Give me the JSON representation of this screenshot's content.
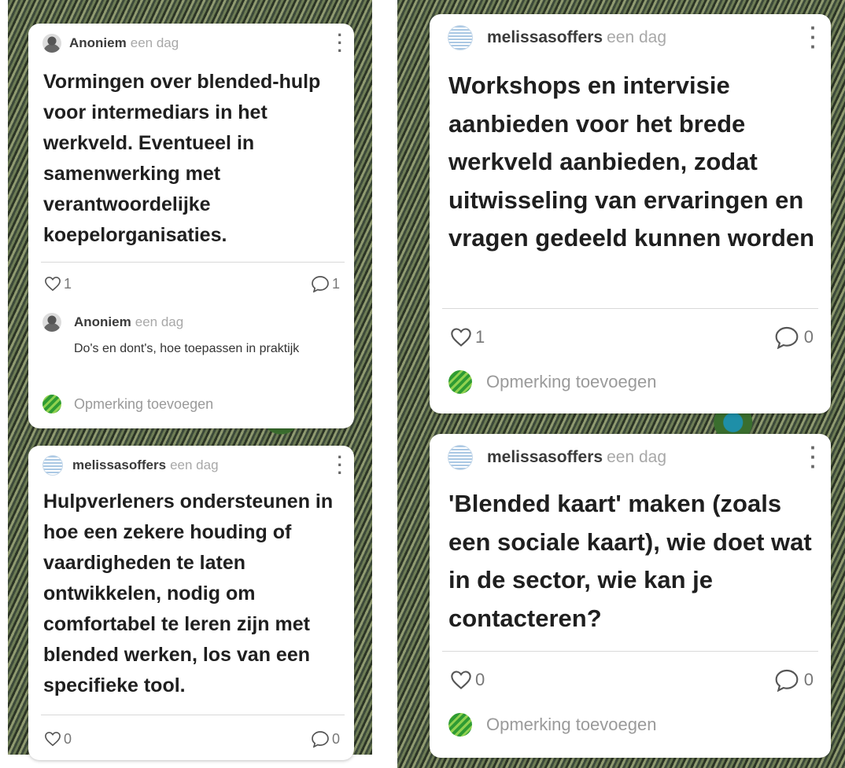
{
  "cards": [
    {
      "author": "Anoniem",
      "time": "een dag",
      "body": "Vormingen over blended-hulp voor intermediars in het werkveld. Eventueel in samenwerking met verantwoordelijke koepelorganisaties.",
      "likes": "1",
      "comments": "1",
      "comment": {
        "author": "Anoniem",
        "time": "een dag",
        "text": "Do's en dont's, hoe toepassen in praktijk"
      },
      "add_comment": "Opmerking toevoegen"
    },
    {
      "author": "melissasoffers",
      "time": "een dag",
      "body": "Hulpverleners ondersteunen in hoe een zekere houding of vaardigheden te laten ontwikkelen, nodig om comfortabel te leren zijn met blended werken, los van een specifieke tool.",
      "likes": "0",
      "comments": "0"
    },
    {
      "author": "melissasoffers",
      "time": "een dag",
      "body": "Workshops en intervisie aanbieden voor het brede werkveld aanbieden, zodat uitwisseling van ervaringen en vragen gedeeld kunnen worden",
      "likes": "1",
      "comments": "0",
      "add_comment": "Opmerking toevoegen"
    },
    {
      "author": "melissasoffers",
      "time": "een dag",
      "body": "'Blended kaart' maken (zoals een sociale kaart), wie doet wat in de sector, wie kan je contacteren?",
      "likes": "0",
      "comments": "0",
      "add_comment": "Opmerking toevoegen"
    }
  ],
  "icons": {
    "like": "heart-icon",
    "comment": "comment-bubble-icon",
    "menu": "more-vertical-icon"
  },
  "colors": {
    "card_bg": "#ffffff",
    "author": "#3a3a3a",
    "muted": "#a8a8a8",
    "body": "#1f1f1f"
  }
}
